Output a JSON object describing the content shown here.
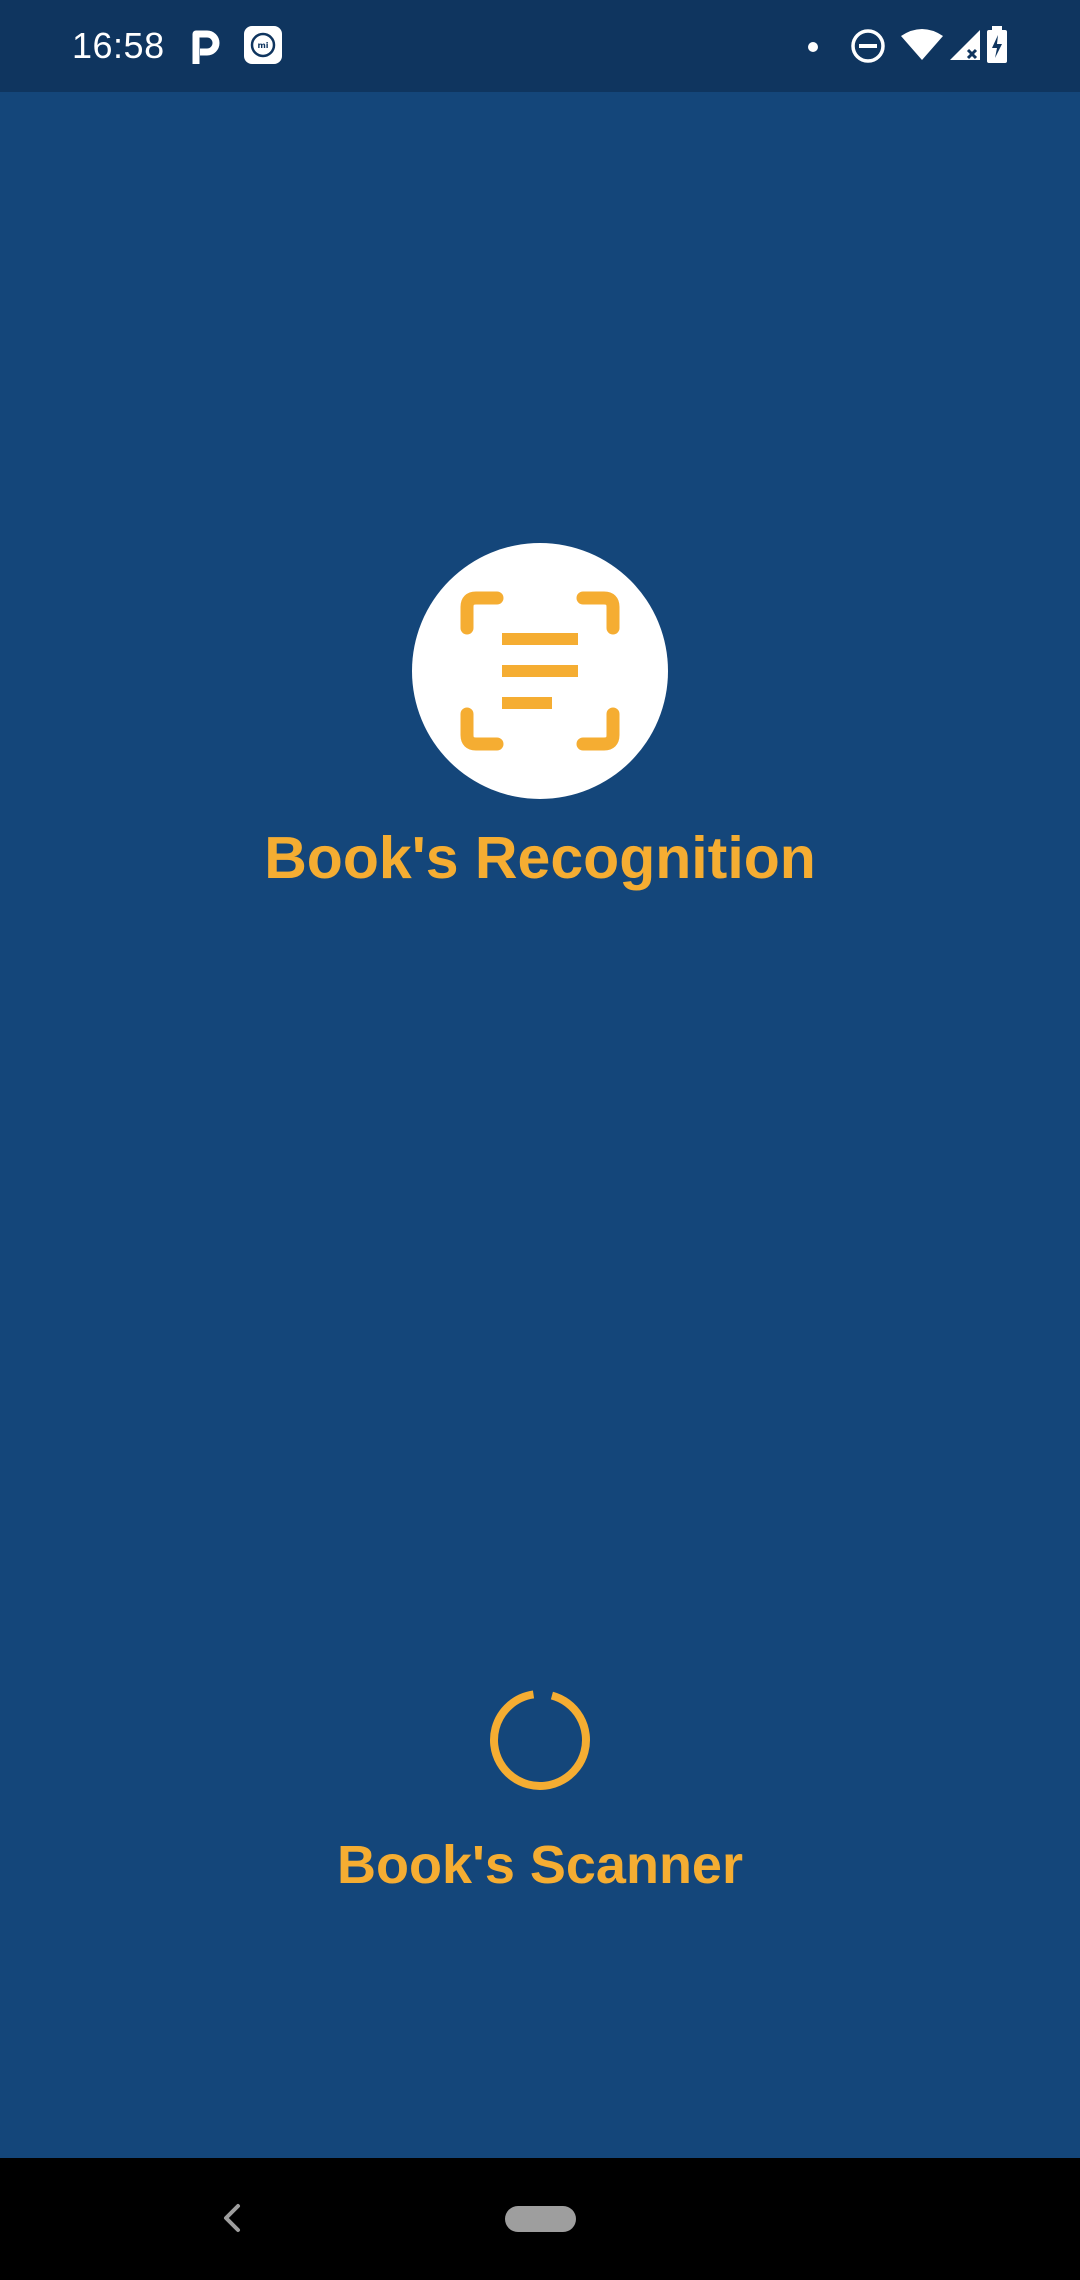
{
  "status_bar": {
    "time": "16:58",
    "left_icons": [
      "parking-icon",
      "mi-app-icon"
    ],
    "right_icons": [
      "notification-dot-icon",
      "do-not-disturb-icon",
      "wifi-icon",
      "cell-signal-icon",
      "battery-charging-icon"
    ]
  },
  "splash": {
    "logo_icon": "text-scan-icon",
    "title": "Book's Recognition",
    "loading_indicator": "progress-spinner-icon",
    "subtitle": "Book's Scanner"
  },
  "nav_bar": {
    "icons": [
      "back-icon",
      "home-pill-icon"
    ]
  },
  "colors": {
    "background": "#14467a",
    "status_bar": "#0f355f",
    "accent": "#f5ad32",
    "logo_background": "#ffffff",
    "nav_bar": "#000000"
  }
}
